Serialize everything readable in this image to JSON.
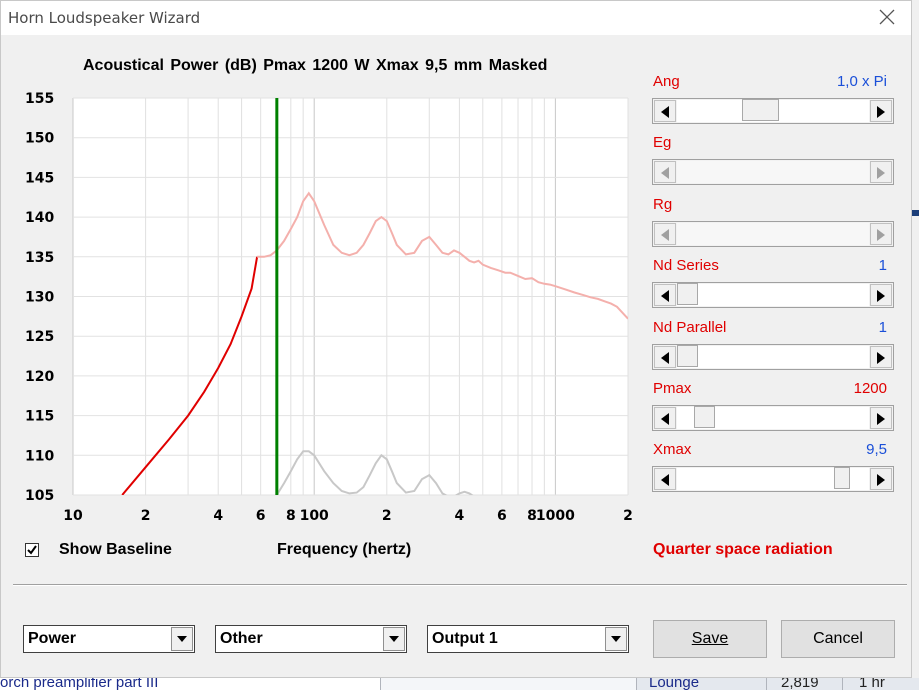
{
  "window": {
    "title": "Horn Loudspeaker Wizard"
  },
  "plot": {
    "title_text": "Acoustical Power (dB)   Pmax 1200 W   Xmax 9,5 mm   Masked",
    "xlabel": "Frequency (hertz)",
    "y_ticks": [
      "155",
      "150",
      "145",
      "140",
      "135",
      "130",
      "125",
      "120",
      "115",
      "110",
      "105"
    ],
    "x_ticks": [
      "10",
      "2",
      "4",
      "6",
      "8",
      "100",
      "2",
      "4",
      "6",
      "8",
      "1000",
      "2"
    ]
  },
  "chart_data": {
    "type": "line",
    "title": "Acoustical Power (dB)   Pmax 1200 W   Xmax 9,5 mm   Masked",
    "xlabel": "Frequency (hertz)",
    "ylabel": "",
    "x_scale": "log",
    "xlim": [
      10,
      2000
    ],
    "ylim": [
      105,
      155
    ],
    "grid": true,
    "marker_x": 70,
    "series": [
      {
        "color": "#e00000",
        "x": [
          16,
          20,
          25,
          30,
          35,
          40,
          45,
          50,
          55,
          58
        ],
        "y": [
          105,
          108.5,
          112,
          115,
          118,
          121,
          124,
          127.5,
          131,
          135
        ]
      },
      {
        "color": "#f4b0ac",
        "x": [
          58,
          62,
          66,
          70,
          75,
          80,
          85,
          90,
          95,
          100,
          110,
          120,
          130,
          140,
          150,
          160,
          170,
          180,
          190,
          200,
          210,
          220,
          240,
          260,
          280,
          300,
          320,
          340,
          360,
          380,
          400,
          420,
          440,
          460,
          480,
          500,
          540,
          580,
          620,
          650,
          700,
          750,
          800,
          850,
          900,
          950,
          1000,
          1100,
          1200,
          1300,
          1400,
          1500,
          1600,
          1700,
          1800,
          2000
        ],
        "y": [
          135,
          135,
          135.2,
          135.8,
          137,
          138.5,
          140,
          142,
          143,
          142,
          139,
          136.5,
          135.5,
          135.2,
          135.5,
          136.5,
          138,
          139.5,
          140,
          139.5,
          138,
          136.5,
          135.3,
          135.5,
          137,
          137.5,
          136.5,
          135.5,
          135.3,
          135.8,
          135.5,
          135,
          134.5,
          134.3,
          134.5,
          134,
          133.6,
          133.3,
          133,
          133,
          132.6,
          132.2,
          132.3,
          131.8,
          131.6,
          131.5,
          131.3,
          130.9,
          130.5,
          130.2,
          129.9,
          129.7,
          129.4,
          129.1,
          128.7,
          127.2
        ]
      },
      {
        "color": "#c8c8c8",
        "x": [
          70,
          75,
          80,
          85,
          90,
          95,
          100,
          110,
          120,
          130,
          140,
          150,
          160,
          170,
          180,
          190,
          200,
          210,
          220,
          240,
          260,
          280,
          300,
          320,
          340,
          360,
          380,
          400,
          420,
          440,
          460,
          480
        ],
        "y": [
          105,
          106.5,
          108,
          109.5,
          110.5,
          110.5,
          110,
          108,
          106.5,
          105.5,
          105.2,
          105.3,
          106,
          107.5,
          109,
          110,
          109.5,
          108,
          106.5,
          105.3,
          105.5,
          107,
          107.5,
          106.5,
          105.2,
          104.8,
          104.8,
          105.2,
          105.4,
          105.2,
          104.8,
          104.5
        ]
      }
    ]
  },
  "controls": [
    {
      "label": "Ang",
      "value": "1,0 x Pi",
      "value_color": "#1a4fd8",
      "thumb_pos": 0.42,
      "thumb_size": 0.19,
      "enabled": true
    },
    {
      "label": "Eg",
      "value": "",
      "value_color": "#1a4fd8",
      "thumb_pos": 0,
      "thumb_size": 0,
      "enabled": false
    },
    {
      "label": "Rg",
      "value": "",
      "value_color": "#1a4fd8",
      "thumb_pos": 0,
      "thumb_size": 0,
      "enabled": false
    },
    {
      "label": "Nd  Series",
      "value": "1",
      "value_color": "#1a4fd8",
      "thumb_pos": 0,
      "thumb_size": 0.11,
      "enabled": true
    },
    {
      "label": "Nd  Parallel",
      "value": "1",
      "value_color": "#1a4fd8",
      "thumb_pos": 0,
      "thumb_size": 0.11,
      "enabled": true
    },
    {
      "label": "Pmax",
      "value": "1200",
      "value_color": "#e00000",
      "thumb_pos": 0.1,
      "thumb_size": 0.11,
      "enabled": true
    },
    {
      "label": "Xmax",
      "value": "9,5",
      "value_color": "#1a4fd8",
      "thumb_pos": 0.89,
      "thumb_size": 0.07,
      "enabled": true
    }
  ],
  "baseline": {
    "label": "Show Baseline",
    "checked": true
  },
  "radiation_text": "Quarter space radiation",
  "dropdowns": [
    {
      "value": "Power"
    },
    {
      "value": "Other"
    },
    {
      "value": "Output 1"
    }
  ],
  "buttons": {
    "save": "Save",
    "cancel": "Cancel"
  },
  "background": {
    "left_text": "orch preamplifier part III",
    "cell_1": "Lounge",
    "cell_2": "2,819",
    "cell_3": "1 hr"
  },
  "colors": {
    "accent_red": "#e00000",
    "accent_blue": "#1a4fd8",
    "marker_green": "#008000"
  }
}
